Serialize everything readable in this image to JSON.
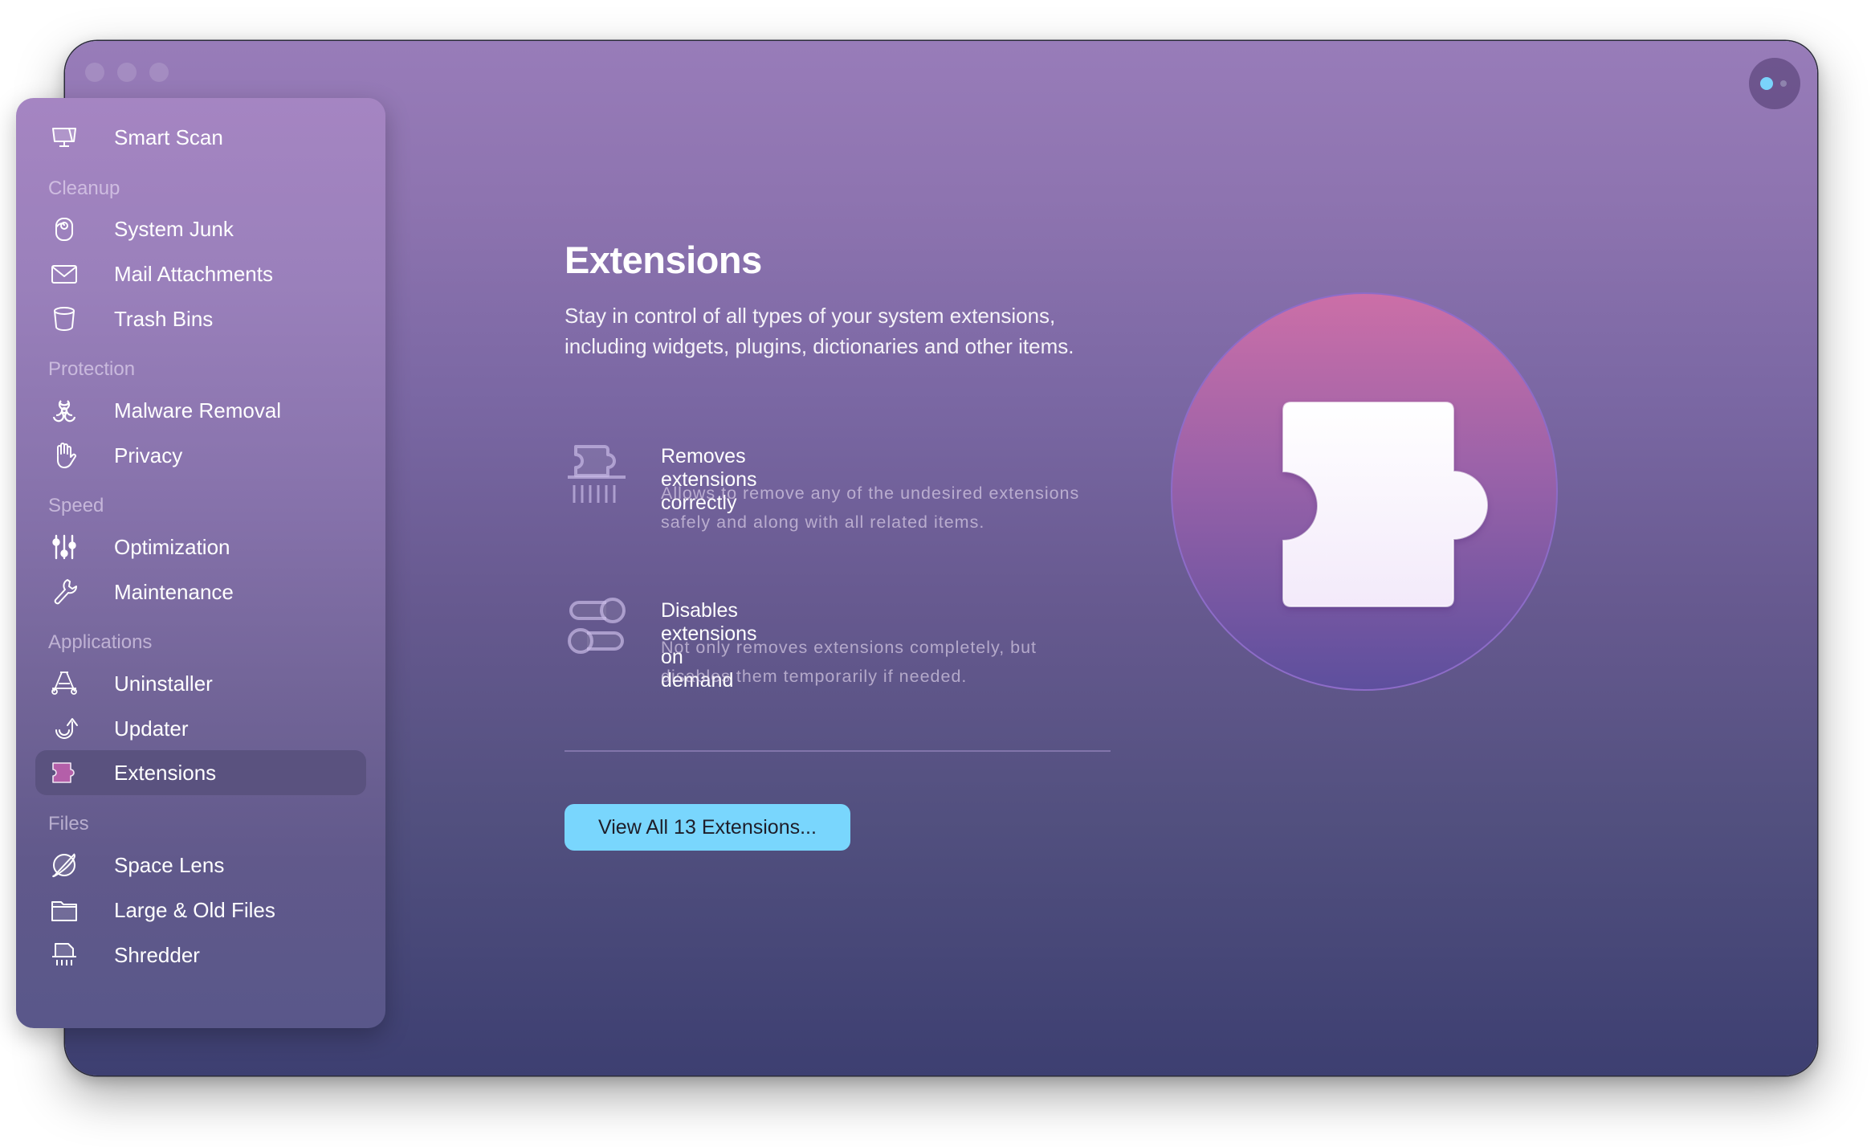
{
  "window": {
    "traffic_lights": [
      "close",
      "minimize",
      "zoom"
    ],
    "assistant_button": {
      "icon": "assistant-dots-icon",
      "accent": "#7ad3fb"
    }
  },
  "sidebar": {
    "items": [
      {
        "type": "item",
        "label": "Smart Scan",
        "icon": "monitor-icon"
      },
      {
        "type": "section",
        "label": "Cleanup"
      },
      {
        "type": "item",
        "label": "System Junk",
        "icon": "junk-icon"
      },
      {
        "type": "item",
        "label": "Mail Attachments",
        "icon": "envelope-icon"
      },
      {
        "type": "item",
        "label": "Trash Bins",
        "icon": "trash-icon"
      },
      {
        "type": "section",
        "label": "Protection"
      },
      {
        "type": "item",
        "label": "Malware Removal",
        "icon": "biohazard-icon"
      },
      {
        "type": "item",
        "label": "Privacy",
        "icon": "hand-icon"
      },
      {
        "type": "section",
        "label": "Speed"
      },
      {
        "type": "item",
        "label": "Optimization",
        "icon": "sliders-icon"
      },
      {
        "type": "item",
        "label": "Maintenance",
        "icon": "wrench-icon"
      },
      {
        "type": "section",
        "label": "Applications"
      },
      {
        "type": "item",
        "label": "Uninstaller",
        "icon": "uninstaller-icon"
      },
      {
        "type": "item",
        "label": "Updater",
        "icon": "update-arrow-icon"
      },
      {
        "type": "item",
        "label": "Extensions",
        "icon": "puzzle-icon",
        "selected": true
      },
      {
        "type": "section",
        "label": "Files"
      },
      {
        "type": "item",
        "label": "Space Lens",
        "icon": "planet-icon"
      },
      {
        "type": "item",
        "label": "Large & Old Files",
        "icon": "folder-icon"
      },
      {
        "type": "item",
        "label": "Shredder",
        "icon": "shredder-icon"
      }
    ]
  },
  "main": {
    "title": "Extensions",
    "description": "Stay in control of all types of your system extensions, including widgets, plugins, dictionaries and other items.",
    "features": [
      {
        "icon": "shredded-puzzle-icon",
        "title": "Removes extensions correctly",
        "description": "Allows to remove any of the undesired extensions safely and along with all related items."
      },
      {
        "icon": "toggles-icon",
        "title": "Disables extensions on demand",
        "description": "Not only removes extensions completely, but disables them temporarily if needed."
      }
    ],
    "cta_label": "View All 13 Extensions...",
    "cta_color": "#79d6fd",
    "hero_icon": "puzzle-hero-icon"
  }
}
